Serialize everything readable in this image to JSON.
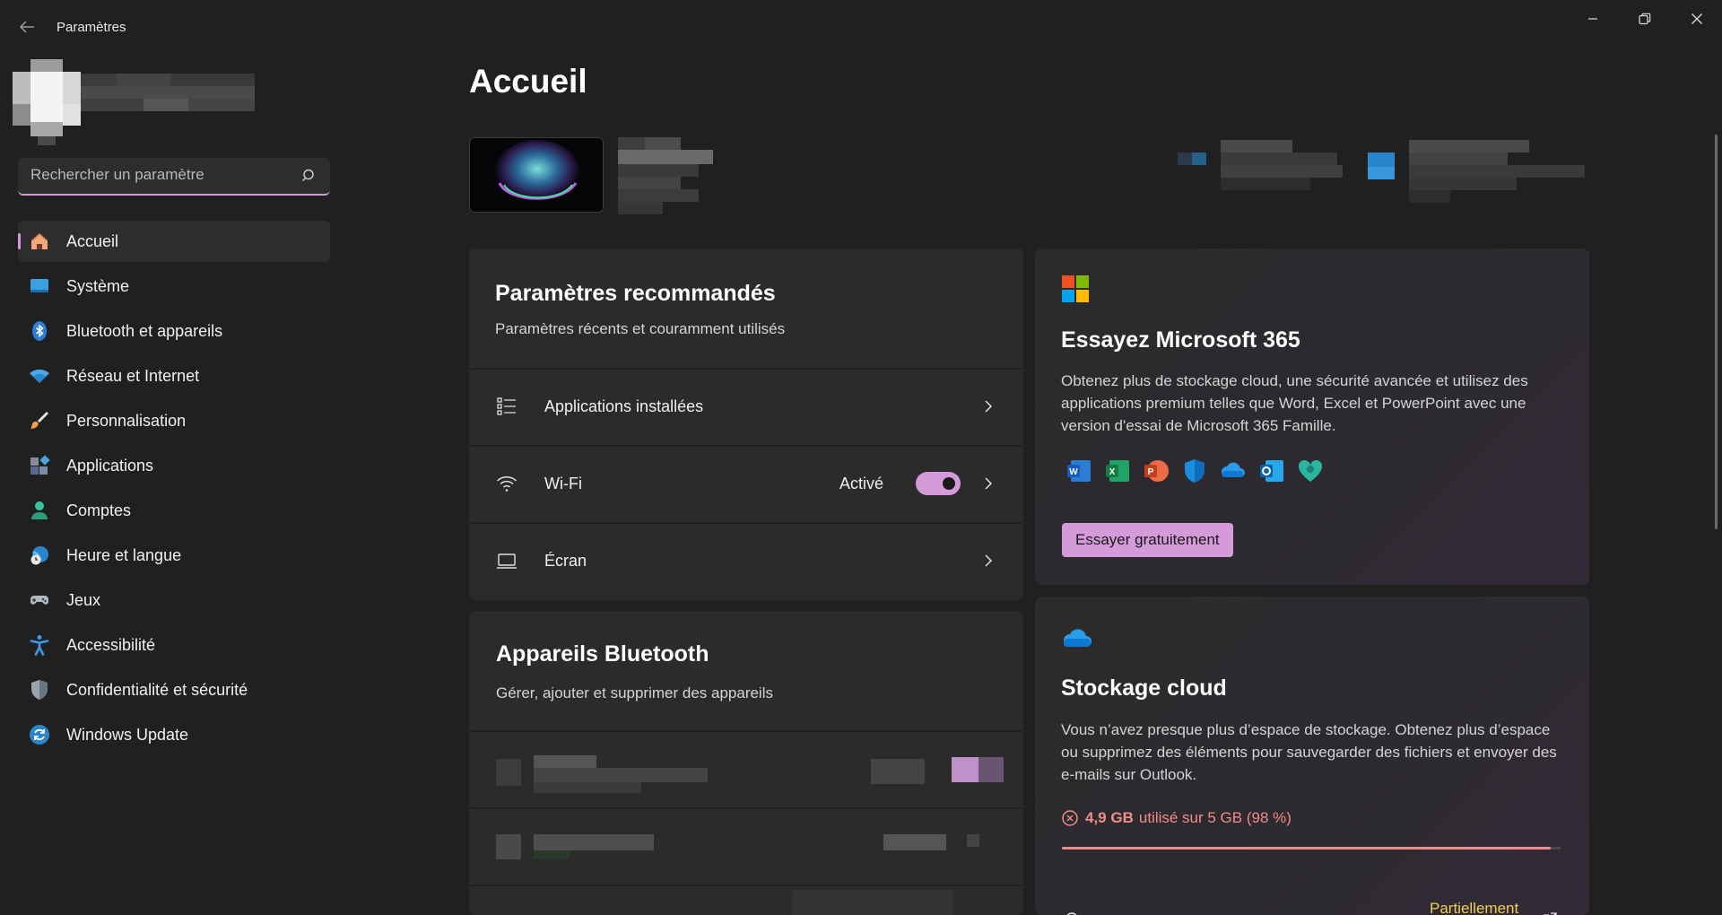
{
  "window": {
    "title": "Paramètres"
  },
  "search": {
    "placeholder": "Rechercher un paramètre"
  },
  "sidebar": {
    "items": [
      {
        "label": "Accueil",
        "icon": "home-icon"
      },
      {
        "label": "Système",
        "icon": "system-icon"
      },
      {
        "label": "Bluetooth et appareils",
        "icon": "bluetooth-icon"
      },
      {
        "label": "Réseau et Internet",
        "icon": "wifi-icon"
      },
      {
        "label": "Personnalisation",
        "icon": "brush-icon"
      },
      {
        "label": "Applications",
        "icon": "apps-icon"
      },
      {
        "label": "Comptes",
        "icon": "person-icon"
      },
      {
        "label": "Heure et langue",
        "icon": "globe-clock-icon"
      },
      {
        "label": "Jeux",
        "icon": "gamepad-icon"
      },
      {
        "label": "Accessibilité",
        "icon": "accessibility-icon"
      },
      {
        "label": "Confidentialité et sécurité",
        "icon": "shield-icon"
      },
      {
        "label": "Windows Update",
        "icon": "update-icon"
      }
    ]
  },
  "main": {
    "title": "Accueil",
    "recommended": {
      "title": "Paramètres recommandés",
      "subtitle": "Paramètres récents et couramment utilisés",
      "rows": [
        {
          "label": "Applications installées"
        },
        {
          "label": "Wi-Fi",
          "status": "Activé"
        },
        {
          "label": "Écran"
        }
      ]
    },
    "bluetooth": {
      "title": "Appareils Bluetooth",
      "subtitle": "Gérer, ajouter et supprimer des appareils"
    },
    "m365": {
      "title": "Essayez Microsoft 365",
      "description": "Obtenez plus de stockage cloud, une sécurité avancée et utilisez des applications premium telles que Word, Excel et PowerPoint avec une version d'essai de Microsoft 365 Famille.",
      "button": "Essayer gratuitement",
      "apps": [
        "word-icon",
        "excel-icon",
        "powerpoint-icon",
        "defender-icon",
        "onedrive-icon",
        "outlook-icon",
        "family-safety-icon"
      ]
    },
    "cloud": {
      "title": "Stockage cloud",
      "description": "Vous n’avez presque plus d’espace de stockage. Obtenez plus d’espace ou supprimez des éléments pour sauvegarder des fichiers et envoyer des e-mails sur Outlook.",
      "used": "4,9 GB",
      "used_suffix": "utilisé sur 5 GB (98 %)",
      "usage_fraction": 0.98,
      "partial_label": "Partiellement"
    }
  },
  "colors": {
    "accent": "#d49ad9",
    "background": "#202020",
    "card": "#2b2b2b",
    "warning": "#ef8c8c",
    "sync_yellow": "#f0d050"
  }
}
